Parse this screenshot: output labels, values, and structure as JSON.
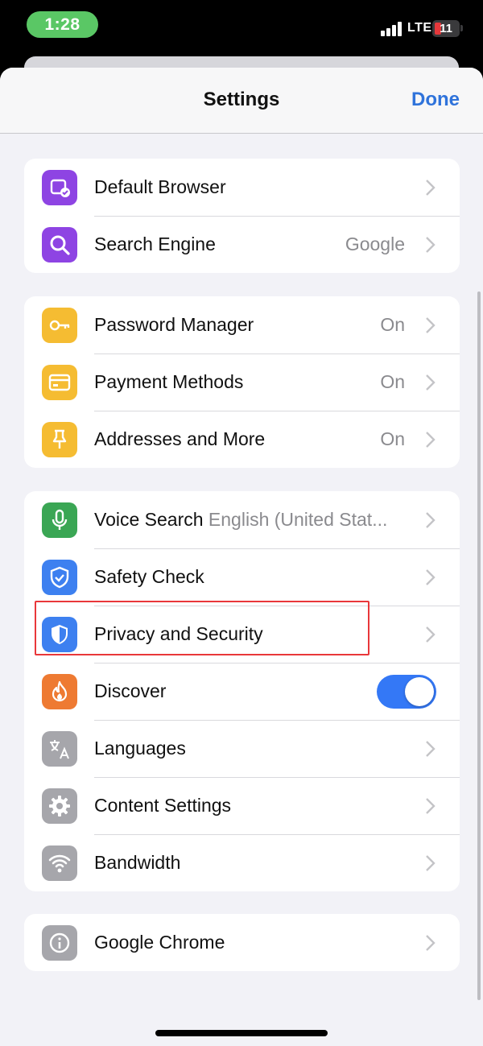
{
  "status_bar": {
    "time": "1:28",
    "network": "LTE",
    "battery": "11"
  },
  "nav": {
    "title": "Settings",
    "done_label": "Done"
  },
  "groups": [
    {
      "rows": [
        {
          "label": "Default Browser",
          "icon": "default-browser-icon",
          "icon_color": "#8e44e3"
        },
        {
          "label": "Search Engine",
          "value": "Google",
          "icon": "search-icon",
          "icon_color": "#8e44e3"
        }
      ]
    },
    {
      "rows": [
        {
          "label": "Password Manager",
          "value": "On",
          "icon": "key-icon",
          "icon_color": "#f5bc32"
        },
        {
          "label": "Payment Methods",
          "value": "On",
          "icon": "credit-card-icon",
          "icon_color": "#f5bc32"
        },
        {
          "label": "Addresses and More",
          "value": "On",
          "icon": "pin-icon",
          "icon_color": "#f5bc32"
        }
      ]
    },
    {
      "rows": [
        {
          "label": "Voice Search",
          "sublabel": "English (United Stat...",
          "icon": "microphone-icon",
          "icon_color": "#3aa654"
        },
        {
          "label": "Safety Check",
          "icon": "shield-check-icon",
          "icon_color": "#3d80f0"
        },
        {
          "label": "Privacy and Security",
          "icon": "shield-icon",
          "icon_color": "#3d80f0"
        },
        {
          "label": "Discover",
          "icon": "flame-icon",
          "icon_color": "#ee7a32",
          "toggle_on": true
        },
        {
          "label": "Languages",
          "icon": "translate-icon",
          "icon_color": "#a6a6ab"
        },
        {
          "label": "Content Settings",
          "icon": "gear-icon",
          "icon_color": "#a6a6ab"
        },
        {
          "label": "Bandwidth",
          "icon": "wifi-icon",
          "icon_color": "#a6a6ab"
        }
      ]
    },
    {
      "rows": [
        {
          "label": "Google Chrome",
          "icon": "info-icon",
          "icon_color": "#a6a6ab"
        }
      ]
    }
  ],
  "colors": {
    "accent": "#2f73db",
    "highlight": "#e9373a",
    "toggle_on": "#3478f6"
  }
}
